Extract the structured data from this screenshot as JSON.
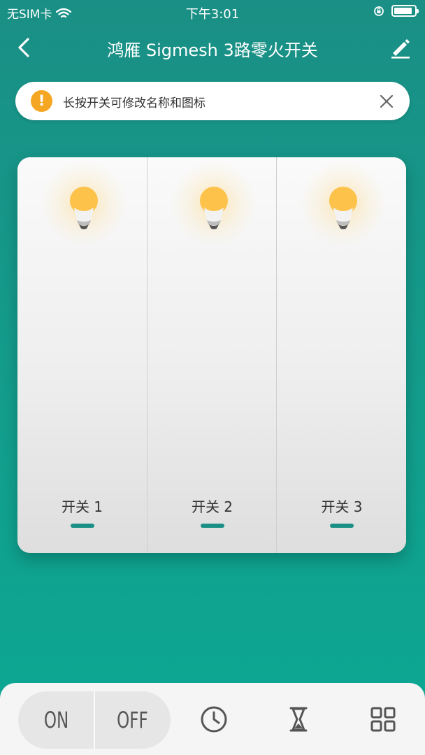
{
  "status_bar": {
    "carrier": "无SIM卡",
    "time": "下午3:01",
    "battery_level": 0.9
  },
  "nav": {
    "title": "鸿雁 Sigmesh 3路零火开关",
    "back_icon": "chevron-left-icon",
    "edit_icon": "pencil-icon"
  },
  "notice": {
    "text": "长按开关可修改名称和图标",
    "icon": "warning-icon",
    "close_icon": "close-icon",
    "accent": "#f5a623"
  },
  "switches": [
    {
      "label": "开关 1",
      "state": "on"
    },
    {
      "label": "开关 2",
      "state": "on"
    },
    {
      "label": "开关 3",
      "state": "on"
    }
  ],
  "bottom_bar": {
    "on_label": "ON",
    "off_label": "OFF",
    "tools": [
      "clock-icon",
      "hourglass-icon",
      "grid-icon"
    ]
  },
  "colors": {
    "background": "#139e8c",
    "indicator": "#1a8f85",
    "bulb": "#fcc24a"
  }
}
